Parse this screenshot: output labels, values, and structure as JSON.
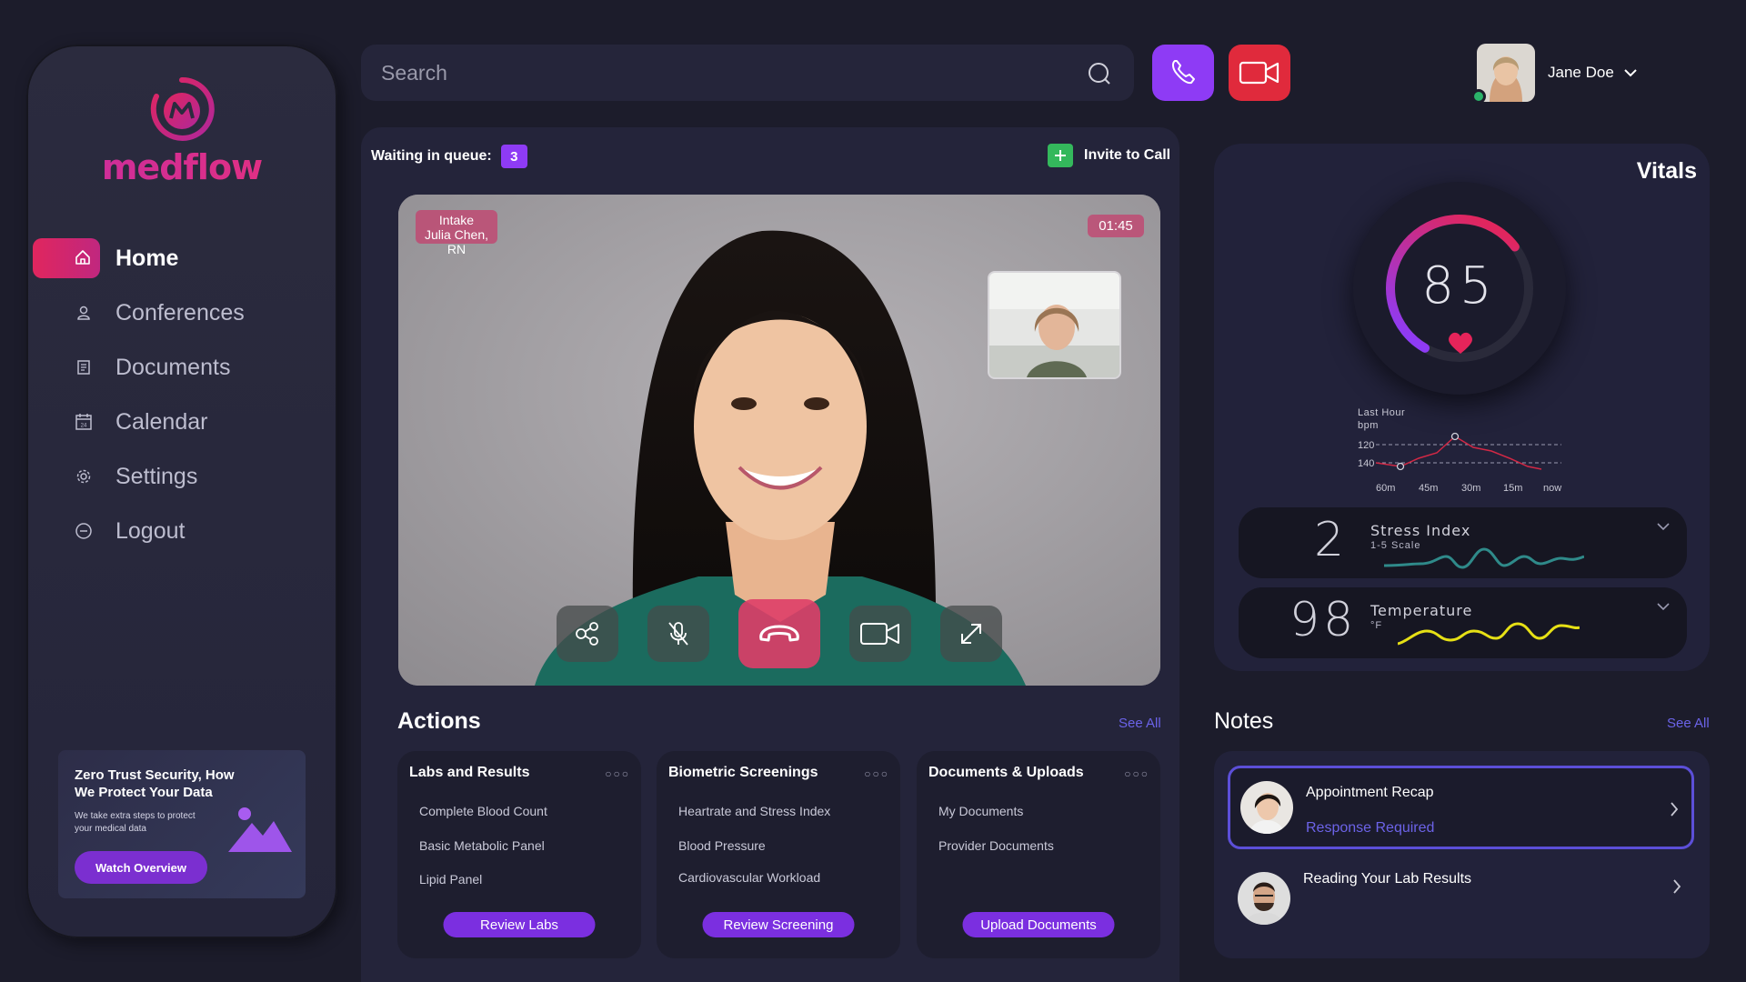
{
  "brand": {
    "name": "medflow",
    "colors": {
      "primary": "#e0265e",
      "accent": "#8e3bf5",
      "link": "#6b63e8"
    }
  },
  "sidebar": {
    "items": [
      {
        "label": "Home",
        "icon": "home-icon",
        "active": true
      },
      {
        "label": "Conferences",
        "icon": "user-icon"
      },
      {
        "label": "Documents",
        "icon": "document-icon"
      },
      {
        "label": "Calendar",
        "icon": "calendar-icon",
        "icon_text": "24"
      },
      {
        "label": "Settings",
        "icon": "gear-icon"
      },
      {
        "label": "Logout",
        "icon": "logout-icon"
      }
    ],
    "promo": {
      "title": "Zero Trust Security, How We Protect Your Data",
      "body": "We take extra steps to protect your medical data",
      "button": "Watch Overview"
    }
  },
  "header": {
    "search_placeholder": "Search",
    "user_name": "Jane Doe"
  },
  "call": {
    "queue_label": "Waiting in queue:",
    "queue_count": "3",
    "invite_label": "Invite to Call",
    "caller_role": "Intake",
    "caller_name": "Julia Chen, RN",
    "timer": "01:45"
  },
  "actions": {
    "title": "Actions",
    "see_all": "See All",
    "cards": [
      {
        "title": "Labs and Results",
        "items": [
          "Complete Blood Count",
          "Basic Metabolic Panel",
          "Lipid Panel"
        ],
        "button": "Review Labs"
      },
      {
        "title": "Biometric Screenings",
        "items": [
          "Heartrate and Stress Index",
          "Blood Pressure",
          "Cardiovascular Workload"
        ],
        "button": "Review Screening"
      },
      {
        "title": "Documents & Uploads",
        "items": [
          "My Documents",
          "Provider Documents"
        ],
        "button": "Upload Documents"
      }
    ]
  },
  "vitals": {
    "title": "Vitals",
    "heart_rate": "85",
    "heart_rate_gauge_fraction": 0.68,
    "chart": {
      "label": "Last Hour",
      "unit": "bpm",
      "y_ticks": [
        "120",
        "140"
      ],
      "x_ticks": [
        "60m",
        "45m",
        "30m",
        "15m",
        "now"
      ]
    },
    "stress": {
      "value": "2",
      "label": "Stress Index",
      "scale": "1-5 Scale"
    },
    "temperature": {
      "value": "98",
      "label": "Temperature",
      "unit": "°F"
    }
  },
  "notes": {
    "title": "Notes",
    "see_all": "See All",
    "items": [
      {
        "title": "Appointment Recap",
        "status": "Response Required"
      },
      {
        "title": "Reading Your Lab Results",
        "status": ""
      }
    ]
  }
}
